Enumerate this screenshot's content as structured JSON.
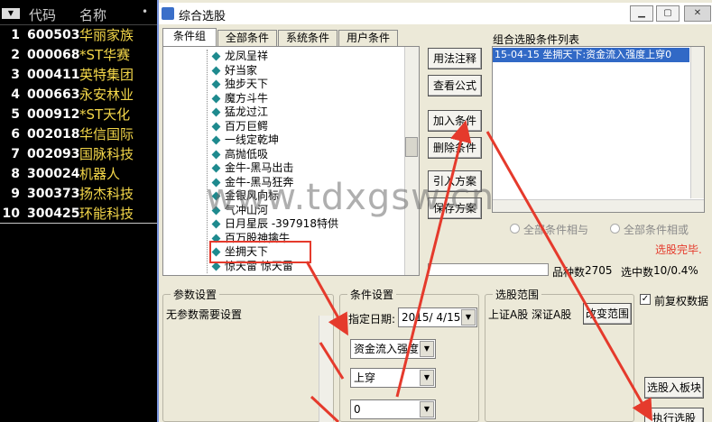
{
  "stock_list": {
    "dropdown": "▼",
    "header_code": "代码",
    "header_name": "名称",
    "header_dot": "•",
    "rows": [
      {
        "n": "1",
        "code": "600503",
        "name": "华丽家族"
      },
      {
        "n": "2",
        "code": "000068",
        "name": "*ST华赛"
      },
      {
        "n": "3",
        "code": "000411",
        "name": "英特集团"
      },
      {
        "n": "4",
        "code": "000663",
        "name": "永安林业"
      },
      {
        "n": "5",
        "code": "000912",
        "name": "*ST天化"
      },
      {
        "n": "6",
        "code": "002018",
        "name": "华信国际"
      },
      {
        "n": "7",
        "code": "002093",
        "name": "国脉科技"
      },
      {
        "n": "8",
        "code": "300024",
        "name": "机器人"
      },
      {
        "n": "9",
        "code": "300373",
        "name": "扬杰科技"
      },
      {
        "n": "10",
        "code": "300425",
        "name": "环能科技"
      }
    ]
  },
  "dialog": {
    "title": "综合选股",
    "min": "▁",
    "max": "▢",
    "close": "✕",
    "tabs": [
      "条件组",
      "全部条件",
      "系统条件",
      "用户条件"
    ],
    "tree_items": [
      "龙凤呈祥",
      "好当家",
      "独步天下",
      "魔方斗牛",
      "猛龙过江",
      "百万巨鳄",
      "一线定乾坤",
      "高抛低吸",
      "金牛-黑马出击",
      "金牛-黑马狂奔",
      "金银风向标",
      "气冲山河",
      "日月星辰 -397918特供",
      "百万股神擒牛",
      "坐拥天下",
      "惊天雷 惊天雷"
    ],
    "buttons": {
      "usage": "用法注释",
      "view_formula": "查看公式",
      "add_condition": "加入条件",
      "delete_condition": "删除条件",
      "import": "引入方案",
      "save": "保存方案"
    },
    "cond_list_label": "组合选股条件列表",
    "cond_list_item": "15-04-15 坐拥天下:资金流入强度上穿0",
    "radio_and": "全部条件相与",
    "radio_or": "全部条件相或",
    "status": "选股完毕.",
    "count_label": "品种数",
    "count_value": "2705",
    "selected_label": "选中数",
    "selected_value": "10/0.4%",
    "params_label": "参数设置",
    "params_text": "无参数需要设置",
    "cond_settings_label": "条件设置",
    "date_label": "指定日期:",
    "date_value": "2015/ 4/15",
    "combo1": "资金流入强度",
    "combo2": "上穿",
    "combo3": "0",
    "range_label": "选股范围",
    "range_text": "上证A股 深证A股",
    "change_range": "改变范围",
    "pre_rights": "前复权数据",
    "to_block": "选股入板块",
    "execute": "执行选股",
    "check": "✓"
  },
  "watermark": "www.tdxgsw.cn",
  "colors": {
    "accent_red": "#e53a2c",
    "stock_name": "#f5d84a",
    "list_highlight": "#3169c6"
  }
}
